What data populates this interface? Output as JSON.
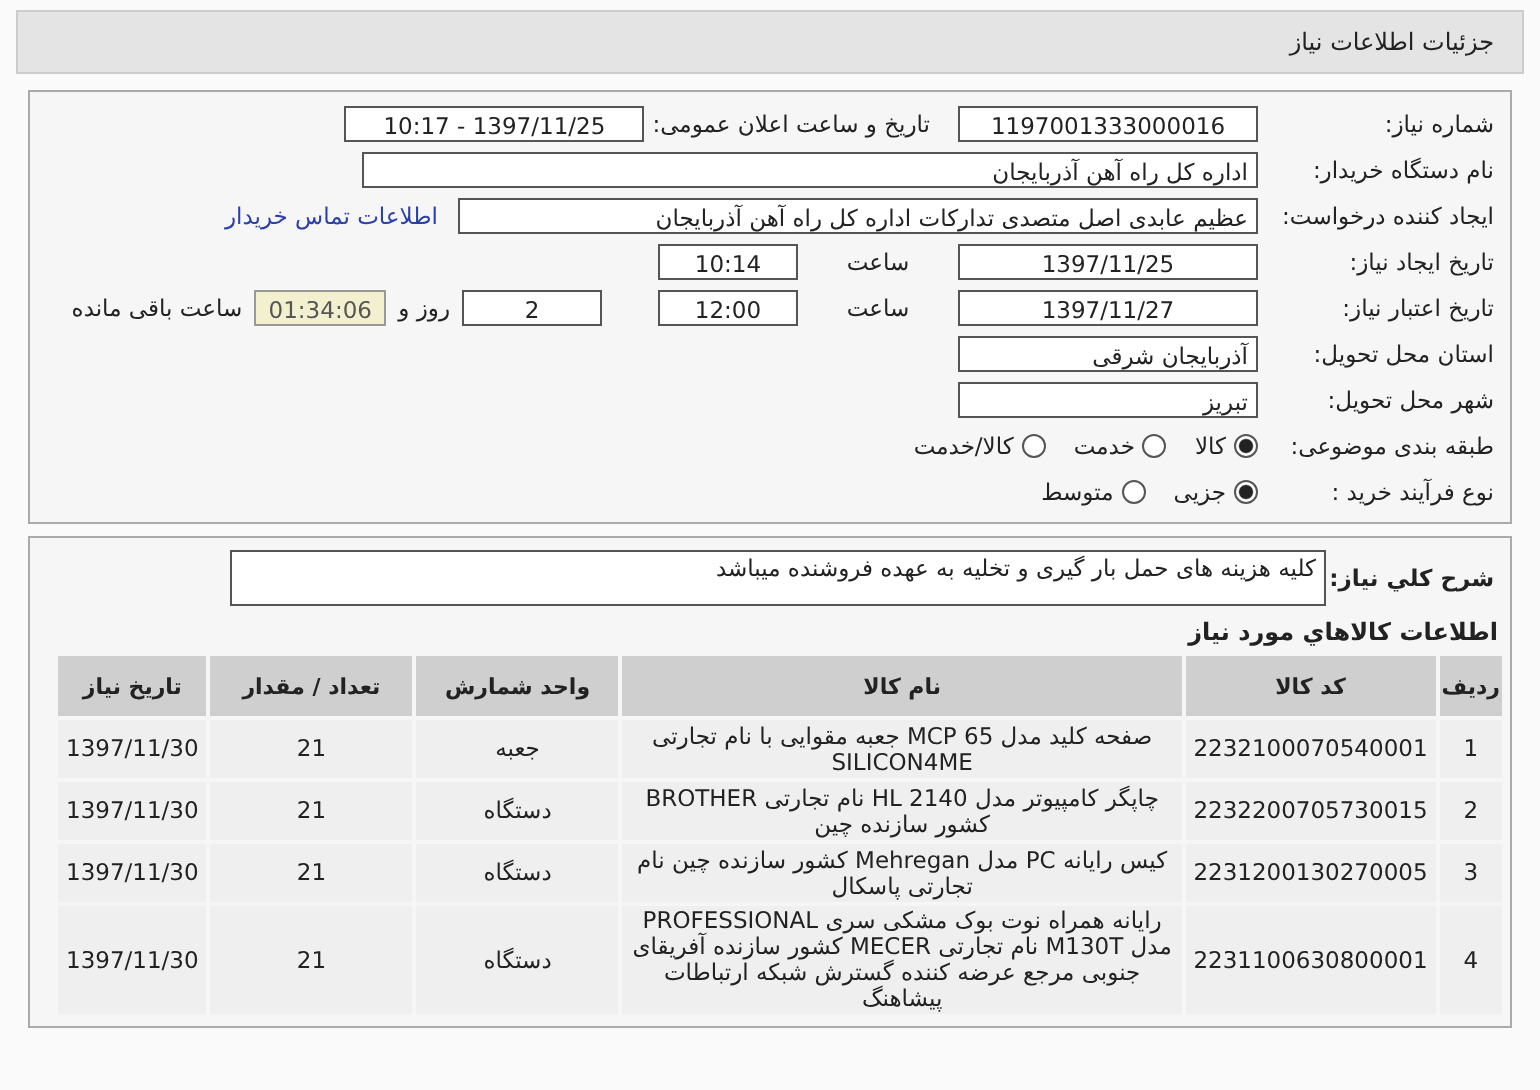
{
  "header": {
    "title": "جزئیات اطلاعات نیاز"
  },
  "fields": {
    "need_number": {
      "label": "شماره نیاز:",
      "value": "1197001333000016"
    },
    "announce": {
      "label": "تاریخ و ساعت اعلان عمومی:",
      "value": "1397/11/25 - 10:17"
    },
    "buyer": {
      "label": "نام دستگاه خریدار:",
      "value": "اداره کل راه آهن آذربایجان"
    },
    "creator": {
      "label": "ایجاد کننده درخواست:",
      "value": "عظیم عابدی اصل متصدی تدارکات اداره کل راه آهن آذربایجان",
      "link": "اطلاعات تماس خریدار"
    },
    "created": {
      "label": "تاریخ ایجاد نیاز:",
      "date": "1397/11/25",
      "time_label": "ساعت",
      "time": "10:14"
    },
    "valid": {
      "label": "تاریخ اعتبار نیاز:",
      "date": "1397/11/27",
      "time_label": "ساعت",
      "time": "12:00",
      "days": "2",
      "days_label": "روز و",
      "remaining": "01:34:06",
      "remaining_label": "ساعت باقی مانده"
    },
    "province": {
      "label": "استان محل تحویل:",
      "value": "آذربایجان شرقی"
    },
    "city": {
      "label": "شهر محل تحویل:",
      "value": "تبریز"
    }
  },
  "radio_groups": [
    {
      "label": "طبقه بندی موضوعی:",
      "options": [
        {
          "label": "کالا",
          "selected": true
        },
        {
          "label": "خدمت",
          "selected": false
        },
        {
          "label": "کالا/خدمت",
          "selected": false
        }
      ]
    },
    {
      "label": "نوع فرآیند خرید :",
      "options": [
        {
          "label": "جزیی",
          "selected": true
        },
        {
          "label": "متوسط",
          "selected": false
        }
      ]
    }
  ],
  "description": {
    "label": "شرح کلي نياز:",
    "value": "کلیه هزینه های حمل بار گیری و تخلیه به عهده فروشنده میباشد"
  },
  "goods": {
    "title": "اطلاعات کالاهاي مورد نياز",
    "columns": [
      "ردیف",
      "کد کالا",
      "نام کالا",
      "واحد شمارش",
      "تعداد / مقدار",
      "تاریخ نیاز"
    ],
    "rows": [
      [
        "1",
        "2232100070540001",
        "صفحه کلید مدل MCP 65 جعبه مقوایی با نام تجارتی SILICON4ME",
        "جعبه",
        "21",
        "1397/11/30"
      ],
      [
        "2",
        "2232200705730015",
        "چاپگر کامپیوتر مدل HL 2140 نام تجارتی BROTHER کشور سازنده چین",
        "دستگاه",
        "21",
        "1397/11/30"
      ],
      [
        "3",
        "2231200130270005",
        "کیس رایانه PC مدل Mehregan کشور سازنده چین نام تجارتی پاسکال",
        "دستگاه",
        "21",
        "1397/11/30"
      ],
      [
        "4",
        "2231100630800001",
        "رایانه همراه نوت بوک مشکی سری PROFESSIONAL مدل M130T نام تجارتی MECER کشور سازنده آفریقای جنوبی مرجع عرضه کننده گسترش شبکه ارتباطات پیشاهنگ",
        "دستگاه",
        "21",
        "1397/11/30"
      ]
    ]
  }
}
